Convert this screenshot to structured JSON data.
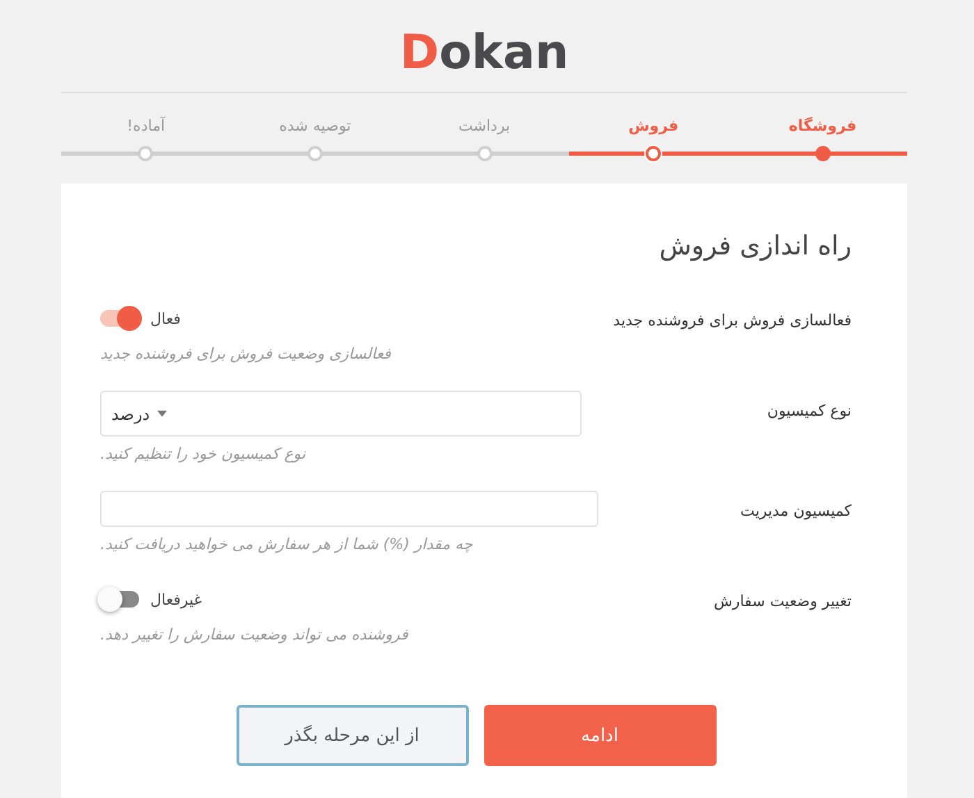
{
  "logo": {
    "initial": "D",
    "rest": "okan"
  },
  "steps": [
    {
      "label": "فروشگاه",
      "completed": true,
      "selected": false
    },
    {
      "label": "فروش",
      "completed": false,
      "selected": true
    },
    {
      "label": "برداشت",
      "completed": false,
      "selected": false
    },
    {
      "label": "توصیه شده",
      "completed": false,
      "selected": false
    },
    {
      "label": "آماده!",
      "completed": false,
      "selected": false
    }
  ],
  "heading": "راه اندازی فروش",
  "fields": [
    {
      "kind": "toggle",
      "label": "فعالسازی فروش برای فروشنده جدید",
      "on": true,
      "state_label": "فعال",
      "help": "فعالسازی وضعیت فروش برای فروشنده جدید"
    },
    {
      "kind": "select",
      "label": "نوع کمیسیون",
      "value": "درصد",
      "help": "نوع کمیسیون خود را تنظیم کنید."
    },
    {
      "kind": "text",
      "label": "کمیسیون مدیریت",
      "help": "چه مقدار (%) شما از هر سفارش می خواهید دریافت کنید."
    },
    {
      "kind": "toggle",
      "label": "تغییر وضعیت سفارش",
      "on": false,
      "state_label": "غیرفعال",
      "help": "فروشنده می تواند وضعیت سفارش را تغییر دهد."
    }
  ],
  "buttons": [
    {
      "kind": "primary",
      "label": "ادامه"
    },
    {
      "kind": "secondary",
      "label": "از این مرحله بگذر"
    }
  ]
}
